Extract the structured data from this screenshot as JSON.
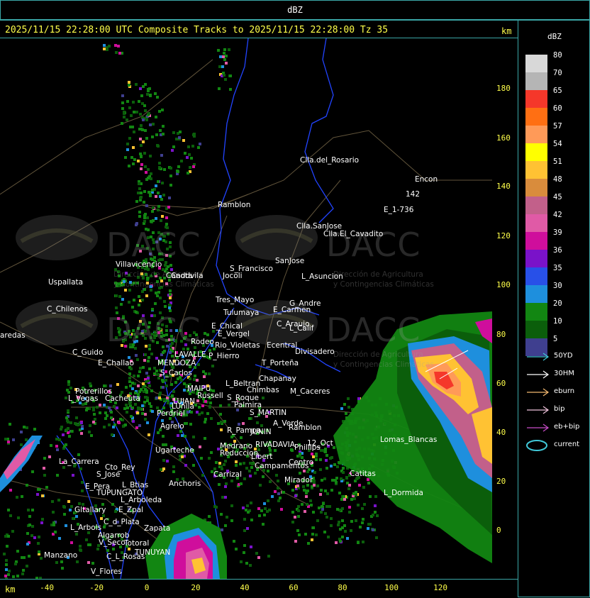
{
  "header": {
    "title": "dBZ",
    "info": "2025/11/15 22:28:00 UTC Composite Tracks to 2025/11/15 22:28:00 Tz 35",
    "unit_top": "km",
    "unit_bottom": "km"
  },
  "axes": {
    "y_ticks": [
      "180",
      "160",
      "140",
      "120",
      "100",
      "80",
      "60",
      "40",
      "20",
      "0"
    ],
    "x_ticks": [
      "-40",
      "-20",
      "0",
      "20",
      "40",
      "60",
      "80",
      "100",
      "120"
    ]
  },
  "watermark": {
    "text": "DACC",
    "sub1": "Dirección de Agricultura",
    "sub2": "y Contingencias Climáticas"
  },
  "legend": {
    "title": "dBZ",
    "levels": [
      {
        "value": "80",
        "color": "#d8d8d8"
      },
      {
        "value": "70",
        "color": "#b5b5b5"
      },
      {
        "value": "65",
        "color": "#f5372a"
      },
      {
        "value": "60",
        "color": "#ff6f13"
      },
      {
        "value": "57",
        "color": "#ff9a58"
      },
      {
        "value": "54",
        "color": "#ffff00"
      },
      {
        "value": "51",
        "color": "#ffc233"
      },
      {
        "value": "48",
        "color": "#d98c3c"
      },
      {
        "value": "45",
        "color": "#c2608a"
      },
      {
        "value": "42",
        "color": "#e05aa6"
      },
      {
        "value": "39",
        "color": "#cf0e9c"
      },
      {
        "value": "36",
        "color": "#7a12c9"
      },
      {
        "value": "35",
        "color": "#2850e8"
      },
      {
        "value": "30",
        "color": "#1e8fdd"
      },
      {
        "value": "20",
        "color": "#128612"
      },
      {
        "value": "10",
        "color": "#0b5e0b"
      },
      {
        "value": "5",
        "color": "#3f3f8f"
      }
    ],
    "tracks": [
      {
        "label": "50YD",
        "color": "#40c8d8"
      },
      {
        "label": "30HM",
        "color": "#ffffff"
      },
      {
        "label": "eburn",
        "color": "#f2b870"
      },
      {
        "label": "bip",
        "color": "#f0c4dc"
      },
      {
        "label": "eb+bip",
        "color": "#c84cc8"
      },
      {
        "label": "current",
        "color": "#40c8d8"
      }
    ]
  },
  "places": [
    {
      "name": "Clla.del_Rosario"
    },
    {
      "name": "Encon"
    },
    {
      "name": "142"
    },
    {
      "name": "E_1-736"
    },
    {
      "name": "Ramblon"
    },
    {
      "name": "Clla.SanJose"
    },
    {
      "name": "Clla.El_Cavadito"
    },
    {
      "name": "Villavicencio"
    },
    {
      "name": "Canota"
    },
    {
      "name": "Caddvila"
    },
    {
      "name": "S_Francisco"
    },
    {
      "name": "SanJose"
    },
    {
      "name": "L_Asuncion"
    },
    {
      "name": "Jocoli"
    },
    {
      "name": "Uspallata"
    },
    {
      "name": "C_Chilenos"
    },
    {
      "name": "Tres_Mayo"
    },
    {
      "name": "Tulumaya"
    },
    {
      "name": "G_Andre"
    },
    {
      "name": "E_Carmen"
    },
    {
      "name": "C_Araujo"
    },
    {
      "name": "L_Calif"
    },
    {
      "name": "E_Chical"
    },
    {
      "name": "E_Vergel"
    },
    {
      "name": "Ecentral"
    },
    {
      "name": "Divisadero"
    },
    {
      "name": "aredas"
    },
    {
      "name": "C_Guido"
    },
    {
      "name": "Rodeo"
    },
    {
      "name": "LAVALLE"
    },
    {
      "name": "Rio_Violetas"
    },
    {
      "name": "P_Hierro"
    },
    {
      "name": "T_Porteña"
    },
    {
      "name": "E_Challao"
    },
    {
      "name": "MENDOZA"
    },
    {
      "name": "S_Carlos"
    },
    {
      "name": "L_Beltran"
    },
    {
      "name": "Chapanay"
    },
    {
      "name": "Chimbas"
    },
    {
      "name": "M_Caceres"
    },
    {
      "name": "Potrerillos"
    },
    {
      "name": "Cacheuta"
    },
    {
      "name": "MAIPU"
    },
    {
      "name": "Russell"
    },
    {
      "name": "L_Vegas"
    },
    {
      "name": "LUJAN"
    },
    {
      "name": "LUnlla"
    },
    {
      "name": "S_Roque"
    },
    {
      "name": "Palmira"
    },
    {
      "name": "S_MARTIN"
    },
    {
      "name": "Perdriel"
    },
    {
      "name": "A_Verde"
    },
    {
      "name": "Agrelo"
    },
    {
      "name": "R_Pampa"
    },
    {
      "name": "JUNIN"
    },
    {
      "name": "Ramblon"
    },
    {
      "name": "Ugarteche"
    },
    {
      "name": "Medrano"
    },
    {
      "name": "RIVADAVIA"
    },
    {
      "name": "Phillips"
    },
    {
      "name": "12_Oct"
    },
    {
      "name": "Lomas_Blancas"
    },
    {
      "name": "Reduccion"
    },
    {
      "name": "Libert"
    },
    {
      "name": "Campamentos"
    },
    {
      "name": "Centro"
    },
    {
      "name": "La_Carrera"
    },
    {
      "name": "Cto_Rey"
    },
    {
      "name": "S_Jose"
    },
    {
      "name": "Carrizal"
    },
    {
      "name": "Catitas"
    },
    {
      "name": "E_Pera"
    },
    {
      "name": "L_Btias"
    },
    {
      "name": "Anchoris"
    },
    {
      "name": "TUPUNGATO"
    },
    {
      "name": "Mirador"
    },
    {
      "name": "L_Dormida"
    },
    {
      "name": "L_Arboleda"
    },
    {
      "name": "Gltallary"
    },
    {
      "name": "E_Zpal"
    },
    {
      "name": "L_Arbols"
    },
    {
      "name": "C_d_Plata"
    },
    {
      "name": "Zapata"
    },
    {
      "name": "Algarrob"
    },
    {
      "name": "V_Seco"
    },
    {
      "name": "Totoral"
    },
    {
      "name": "Manzano"
    },
    {
      "name": "C_L_Rosas"
    },
    {
      "name": "TUNUYAN"
    },
    {
      "name": "V_Flores"
    }
  ]
}
